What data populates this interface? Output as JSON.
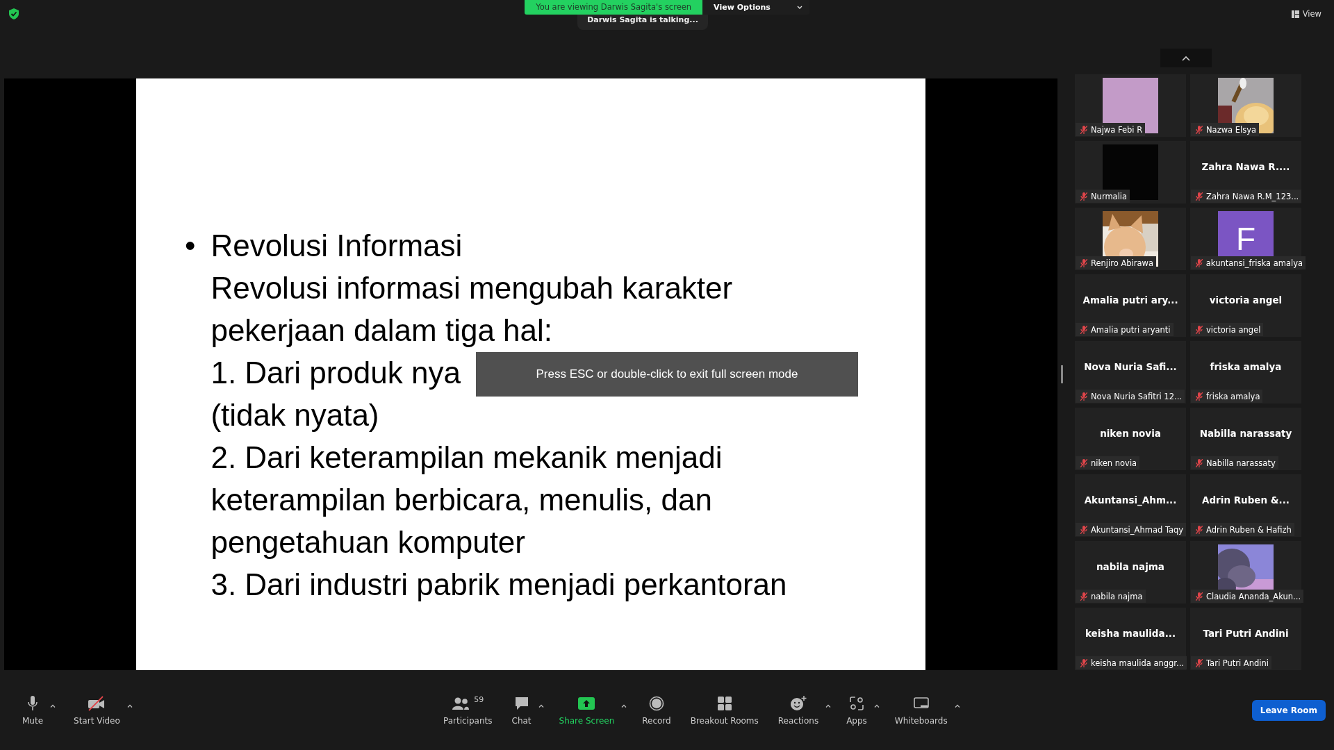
{
  "top_bar": {
    "banner": "You are viewing Darwis Sagita's screen",
    "view_options": "View Options",
    "talking": "Darwis Sagita is talking...",
    "view": "View"
  },
  "slide": {
    "bullet": "•",
    "lines": [
      "Revolusi Informasi",
      "Revolusi informasi mengubah karakter",
      "pekerjaan dalam tiga hal:",
      "1. Dari produk nya",
      "(tidak nyata)",
      "2. Dari keterampilan mekanik menjadi",
      "keterampilan berbicara, menulis, dan",
      "pengetahuan komputer",
      "3. Dari industri pabrik menjadi perkantoran"
    ]
  },
  "fullscreen_notice": "Press ESC or double-click to exit full screen mode",
  "participants": [
    {
      "kind": "blank",
      "color": "#c39bc8",
      "label": "Najwa Febi R",
      "muted": true
    },
    {
      "kind": "picture",
      "label": "Nazwa Elsya",
      "muted": true
    },
    {
      "kind": "blank",
      "color": "#050505",
      "label": "Nurmalia",
      "muted": true
    },
    {
      "kind": "name",
      "name": "Zahra Nawa R....",
      "label": "Zahra Nawa R.M_123...",
      "muted": true
    },
    {
      "kind": "picture",
      "label": "Renjiro Abirawa",
      "muted": true
    },
    {
      "kind": "avatar",
      "initial": "F",
      "color": "#7b55c3",
      "label": "akuntansi_friska amalya",
      "muted": true
    },
    {
      "kind": "name",
      "name": "Amalia putri ary...",
      "label": "Amalia putri aryanti",
      "muted": true
    },
    {
      "kind": "name",
      "name": "victoria angel",
      "label": "victoria angel",
      "muted": true
    },
    {
      "kind": "name",
      "name": "Nova Nuria Safi...",
      "label": "Nova Nuria Safitri 12...",
      "muted": true
    },
    {
      "kind": "name",
      "name": "friska amalya",
      "label": "friska amalya",
      "muted": true
    },
    {
      "kind": "name",
      "name": "niken novia",
      "label": "niken novia",
      "muted": true
    },
    {
      "kind": "name",
      "name": "Nabilla narassaty",
      "label": "Nabilla narassaty",
      "muted": true
    },
    {
      "kind": "name",
      "name": "Akuntansi_Ahm...",
      "label": "Akuntansi_Ahmad Taqy",
      "muted": true
    },
    {
      "kind": "name",
      "name": "Adrin Ruben &...",
      "label": "Adrin Ruben & Hafizh",
      "muted": true
    },
    {
      "kind": "name",
      "name": "nabila najma",
      "label": "nabila najma",
      "muted": true
    },
    {
      "kind": "picture",
      "label": "Claudia Ananda_Akun...",
      "muted": true
    },
    {
      "kind": "name",
      "name": "keisha  maulida...",
      "label": "keisha maulida anggr...",
      "muted": true
    },
    {
      "kind": "name",
      "name": "Tari Putri Andini",
      "label": "Tari Putri Andini",
      "muted": true
    }
  ],
  "toolbar": [
    {
      "kind": "mic",
      "label": "Mute",
      "caret": true
    },
    {
      "kind": "video_off",
      "label": "Start Video",
      "caret": true
    },
    {
      "kind": "participants",
      "label": "Participants",
      "count": "59",
      "caret": false
    },
    {
      "kind": "chat",
      "label": "Chat",
      "caret": true
    },
    {
      "kind": "share",
      "label": "Share Screen",
      "caret": true
    },
    {
      "kind": "record",
      "label": "Record",
      "caret": false
    },
    {
      "kind": "breakout",
      "label": "Breakout Rooms",
      "caret": false
    },
    {
      "kind": "reactions",
      "label": "Reactions",
      "caret": true
    },
    {
      "kind": "apps",
      "label": "Apps",
      "caret": true
    },
    {
      "kind": "whiteboard",
      "label": "Whiteboards",
      "caret": true
    }
  ],
  "leave_button": "Leave Room"
}
